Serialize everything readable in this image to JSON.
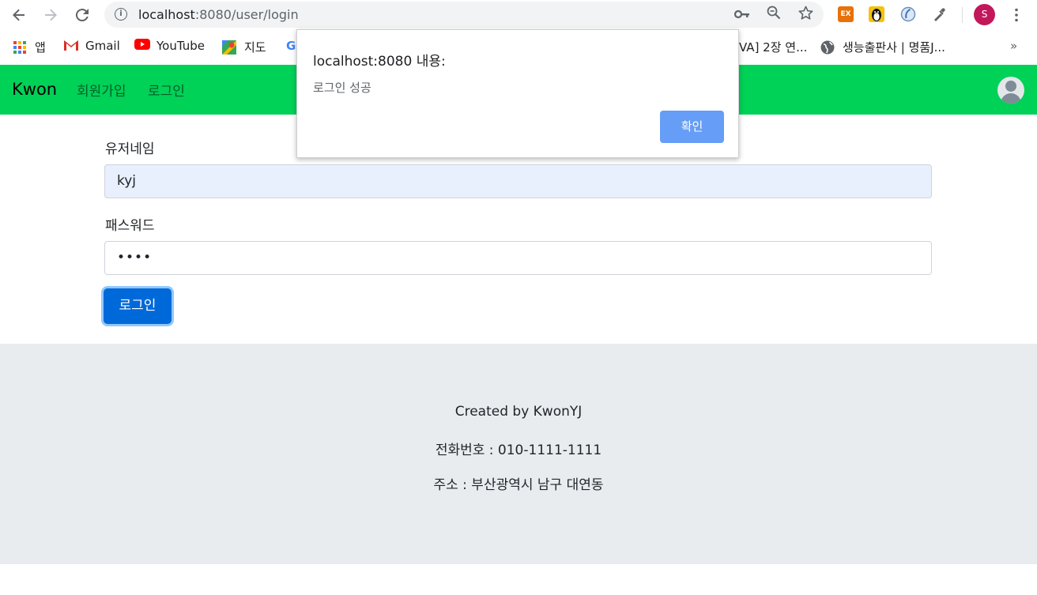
{
  "browser": {
    "url_host": "localhost",
    "url_path": ":8080/user/login",
    "profile_initial": "S",
    "extensions": [
      "EX"
    ]
  },
  "bookmarks": {
    "items": [
      {
        "label": "앱"
      },
      {
        "label": "Gmail"
      },
      {
        "label": "YouTube"
      },
      {
        "label": "지도"
      },
      {
        "label": "G"
      },
      {
        "label": "VA] 2장 연..."
      },
      {
        "label": "생능출판사 | 명품J..."
      }
    ],
    "more": "»"
  },
  "navbar": {
    "brand": "Kwon",
    "links": [
      "회원가입",
      "로그인"
    ]
  },
  "form": {
    "username_label": "유저네임",
    "username_value": "kyj",
    "password_label": "패스워드",
    "password_value": "••••",
    "submit_label": "로그인"
  },
  "footer": {
    "created": "Created by KwonYJ",
    "phone": "전화번호 : 010-1111-1111",
    "address": "주소 : 부산광역시 남구 대연동"
  },
  "dialog": {
    "title": "localhost:8080 내용:",
    "message": "로그인 성공",
    "ok_label": "확인"
  },
  "colors": {
    "navbar": "#00d157",
    "primary_button": "#0069d9",
    "dialog_button": "#669df6",
    "footer_bg": "#e9ecef"
  }
}
